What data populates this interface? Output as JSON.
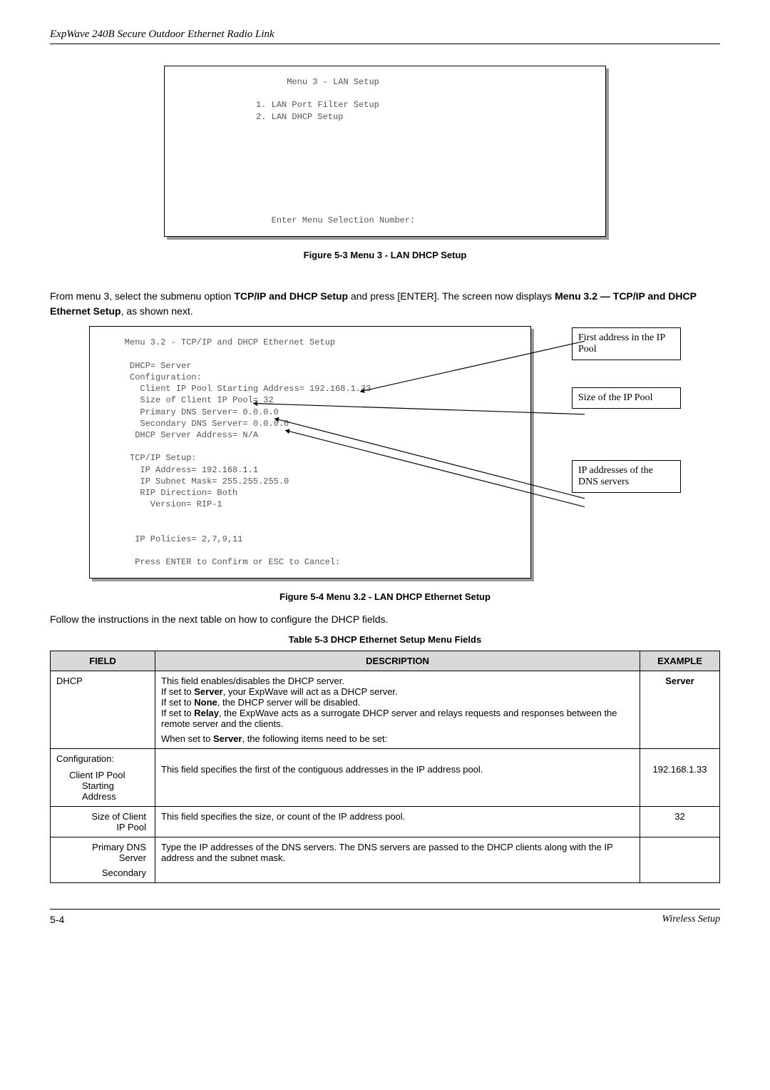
{
  "header": "ExpWave 240B Secure Outdoor Ethernet Radio Link",
  "terminal1": "                     Menu 3 - LAN Setup\n\n               1. LAN Port Filter Setup\n               2. LAN DHCP Setup\n\n\n\n\n\n\n\n\n                  Enter Menu Selection Number:",
  "caption1": "Figure 5-3 Menu 3 - LAN DHCP Setup",
  "body1_a": "From menu 3, select the submenu option ",
  "body1_b": "TCP/IP and DHCP Setup",
  "body1_c": " and press [ENTER]. The screen now displays ",
  "body1_d": "Menu 3.2 — TCP/IP and DHCP Ethernet Setup",
  "body1_e": ", as shown next.",
  "terminal2": "    Menu 3.2 - TCP/IP and DHCP Ethernet Setup\n\n     DHCP= Server\n     Configuration:\n       Client IP Pool Starting Address= 192.168.1.33\n       Size of Client IP Pool= 32\n       Primary DNS Server= 0.0.0.0\n       Secondary DNS Server= 0.0.0.0\n      DHCP Server Address= N/A\n\n     TCP/IP Setup:\n       IP Address= 192.168.1.1\n       IP Subnet Mask= 255.255.255.0\n       RIP Direction= Both\n         Version= RIP-1\n\n\n      IP Policies= 2,7,9,11\n\n      Press ENTER to Confirm or ESC to Cancel:",
  "callout1": "First address in the IP Pool",
  "callout2": "Size of the IP Pool",
  "callout3": "IP addresses of the DNS servers",
  "caption2": "Figure 5-4 Menu 3.2 - LAN DHCP Ethernet Setup",
  "body2": "Follow the instructions in the next table on how to configure the DHCP fields.",
  "tablecaption": "Table 5-3 DHCP Ethernet Setup Menu Fields",
  "th_field": "FIELD",
  "th_desc": "DESCRIPTION",
  "th_ex": "EXAMPLE",
  "r1_f": "DHCP",
  "r1_d1": "This field enables/disables the DHCP server.",
  "r1_d2a": "If set to ",
  "r1_d2b": "Server",
  "r1_d2c": ", your ExpWave will act as a DHCP server.",
  "r1_d3a": "If set to ",
  "r1_d3b": "None",
  "r1_d3c": ", the DHCP server will be disabled.",
  "r1_d4a": "If set to ",
  "r1_d4b": "Relay",
  "r1_d4c": ", the ExpWave acts as a surrogate DHCP server and relays requests and responses between the remote server and the clients.",
  "r1_d5a": "When set to ",
  "r1_d5b": "Server",
  "r1_d5c": ", the following items need to be set:",
  "r1_e": "Server",
  "r2_f": "Configuration:",
  "r2_f2a": "Client IP Pool",
  "r2_f2b": "Starting",
  "r2_f2c": "Address",
  "r2_d": "This field specifies the first of the contiguous addresses in the IP address pool.",
  "r2_e": "192.168.1.33",
  "r3_fa": "Size of Client",
  "r3_fb": "IP Pool",
  "r3_d": "This field specifies the size, or count of the IP address pool.",
  "r3_e": "32",
  "r4_fa": "Primary DNS",
  "r4_fb": "Server",
  "r4_fc": "Secondary",
  "r4_d": "Type the IP addresses of the DNS servers. The DNS servers are passed to the DHCP clients along with the IP address and the subnet mask.",
  "footer_left": "5-4",
  "footer_right": "Wireless Setup"
}
